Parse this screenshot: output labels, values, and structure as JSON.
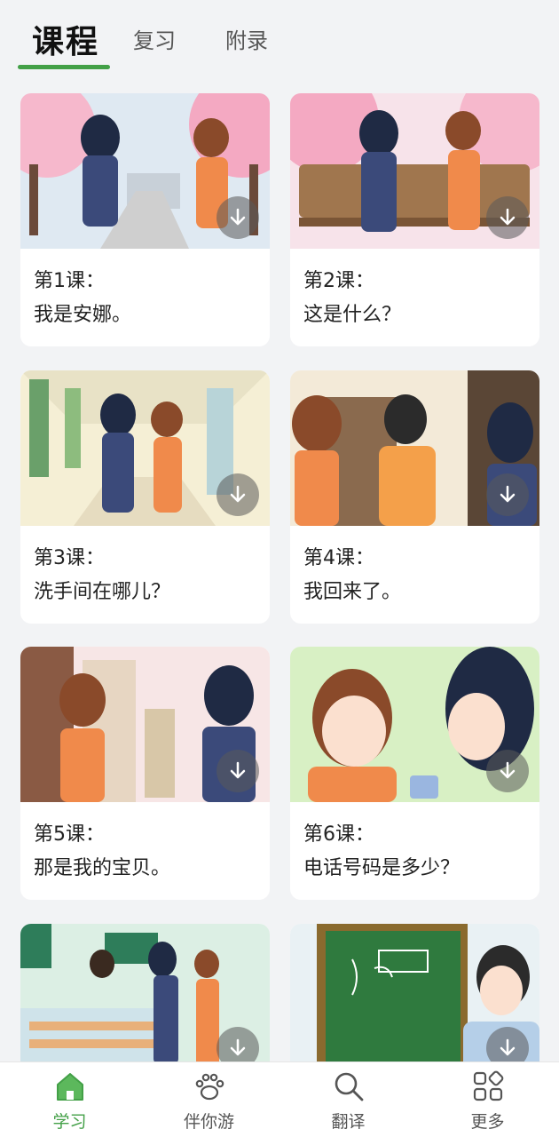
{
  "top_tabs": {
    "course": "课程",
    "review": "复习",
    "appendix": "附录"
  },
  "lessons": [
    {
      "no": "第1课：",
      "title": "我是安娜。"
    },
    {
      "no": "第2课：",
      "title": "这是什么？"
    },
    {
      "no": "第3课：",
      "title": "洗手间在哪儿？"
    },
    {
      "no": "第4课：",
      "title": "我回来了。"
    },
    {
      "no": "第5课：",
      "title": "那是我的宝贝。"
    },
    {
      "no": "第6课：",
      "title": "电话号码是多少？"
    },
    {
      "no": "",
      "title": ""
    },
    {
      "no": "",
      "title": ""
    }
  ],
  "bottom_nav": [
    {
      "label": "学习",
      "icon": "home-icon",
      "active": true
    },
    {
      "label": "伴你游",
      "icon": "paw-icon",
      "active": false
    },
    {
      "label": "翻译",
      "icon": "search-icon",
      "active": false
    },
    {
      "label": "更多",
      "icon": "grid-icon",
      "active": false
    }
  ],
  "colors": {
    "accent": "#43a047",
    "background": "#f2f3f5",
    "card": "#ffffff"
  }
}
